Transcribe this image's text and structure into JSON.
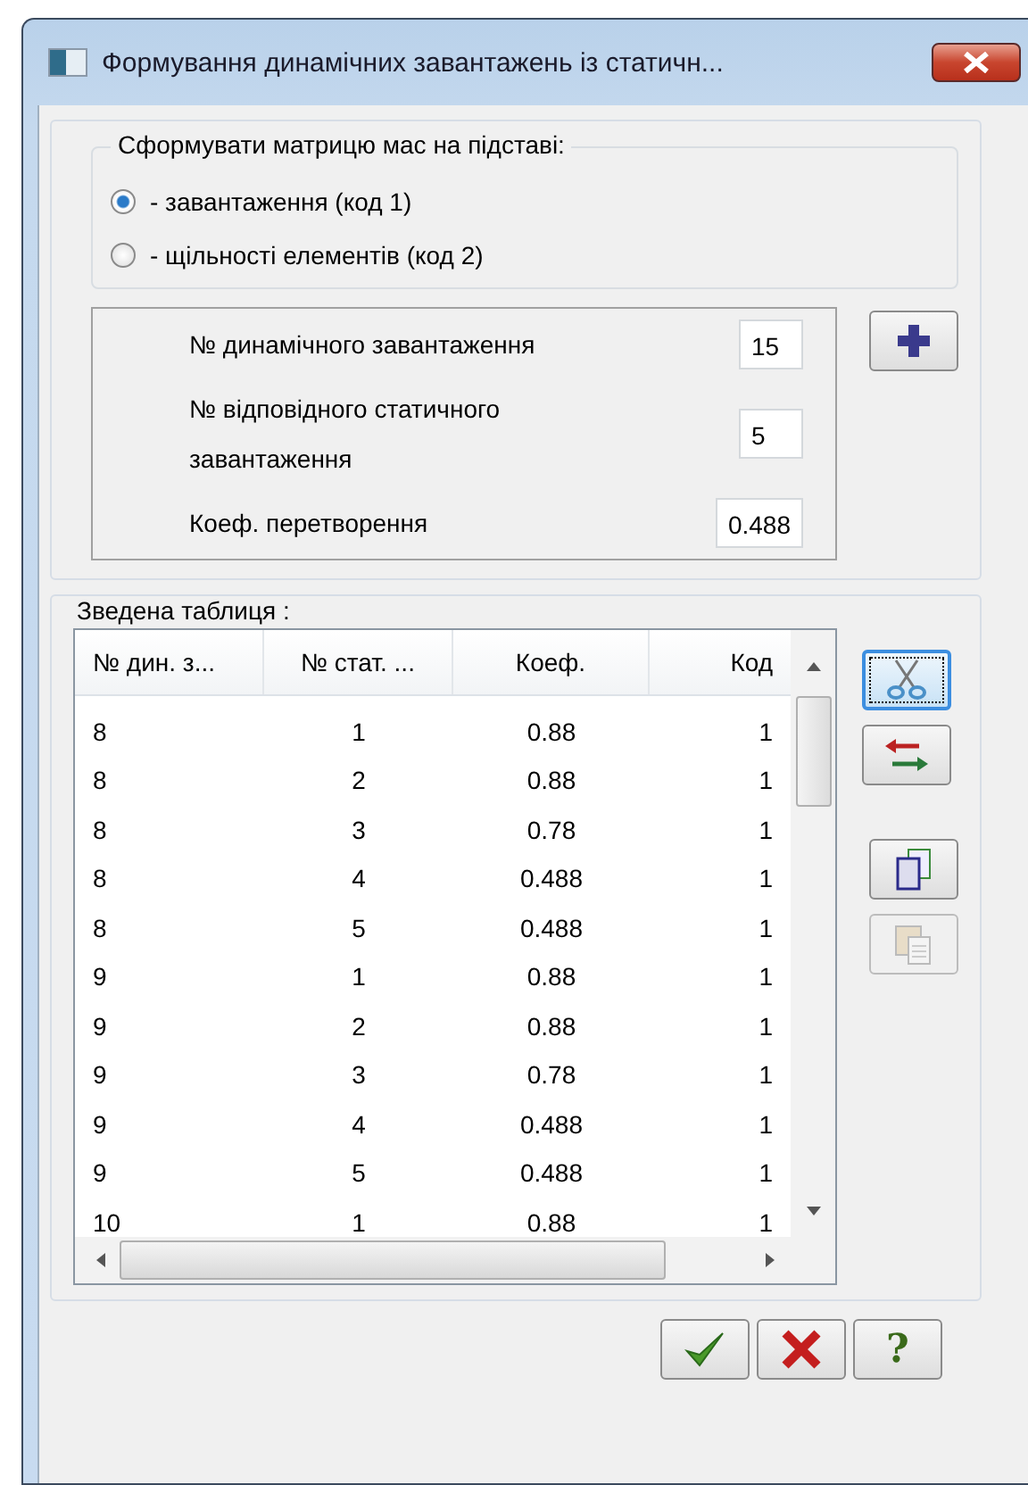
{
  "window": {
    "title": "Формування динамічних завантажень із статичн..."
  },
  "mass_basis": {
    "title": "Сформувати матрицю мас на підставі:",
    "options": [
      {
        "label": "- завантаження (код 1)",
        "selected": true
      },
      {
        "label": "- щільності елементів (код 2)",
        "selected": false
      }
    ]
  },
  "inputs": [
    {
      "label": "№  динамічного завантаження",
      "value": "15"
    },
    {
      "label": "№ відповідного статичного завантаження",
      "value": "5"
    },
    {
      "label": "Коеф. перетворення",
      "value": "0.488"
    }
  ],
  "summary": {
    "title": "Зведена таблиця :",
    "columns": [
      "№ дин. з...",
      "№ стат. ...",
      "Коеф.",
      "Код"
    ],
    "rows": [
      [
        "8",
        "1",
        "0.88",
        "1"
      ],
      [
        "8",
        "2",
        "0.88",
        "1"
      ],
      [
        "8",
        "3",
        "0.78",
        "1"
      ],
      [
        "8",
        "4",
        "0.488",
        "1"
      ],
      [
        "8",
        "5",
        "0.488",
        "1"
      ],
      [
        "9",
        "1",
        "0.88",
        "1"
      ],
      [
        "9",
        "2",
        "0.88",
        "1"
      ],
      [
        "9",
        "3",
        "0.78",
        "1"
      ],
      [
        "9",
        "4",
        "0.488",
        "1"
      ],
      [
        "9",
        "5",
        "0.488",
        "1"
      ],
      [
        "10",
        "1",
        "0.88",
        "1"
      ]
    ]
  },
  "side_buttons": [
    {
      "kind": "cut",
      "focused": true,
      "disabled": false
    },
    {
      "kind": "swap",
      "focused": false,
      "disabled": false
    },
    {
      "kind": "copy",
      "focused": false,
      "disabled": false
    },
    {
      "kind": "paste",
      "focused": false,
      "disabled": true
    }
  ],
  "dialog_buttons": [
    {
      "kind": "ok"
    },
    {
      "kind": "cancel"
    },
    {
      "kind": "help",
      "label": "?"
    }
  ]
}
